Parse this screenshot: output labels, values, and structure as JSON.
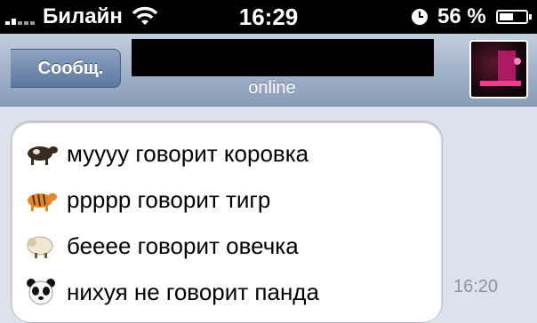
{
  "status_bar": {
    "carrier": "Билайн",
    "time": "16:29",
    "battery": "56 %",
    "battery_level": 0.56
  },
  "nav": {
    "back_label": "Сообщ.",
    "contact_name": "",
    "status": "online"
  },
  "messages": [
    {
      "icon": "cow-emoji",
      "text": "муууу говорит коровка"
    },
    {
      "icon": "tiger-emoji",
      "text": "ррррр говорит тигр"
    },
    {
      "icon": "sheep-emoji",
      "text": "беееe говорит овечка"
    },
    {
      "icon": "panda-emoji",
      "text": "нихуя не говорит панда"
    }
  ],
  "timestamp": "16:20"
}
